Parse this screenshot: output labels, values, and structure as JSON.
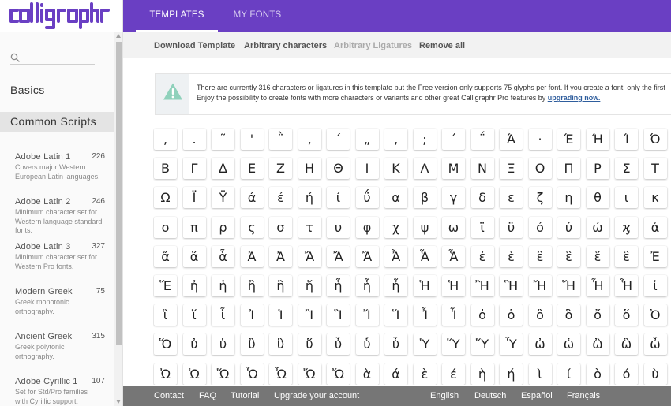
{
  "app": {
    "logo_text": "calligraphr"
  },
  "colors": {
    "accent": "#6a3fc3",
    "footer": "#767676",
    "link": "#2e5d9d"
  },
  "nav": {
    "tabs": [
      {
        "label": "TEMPLATES",
        "active": true
      },
      {
        "label": "MY FONTS",
        "active": false
      }
    ]
  },
  "toolbar": {
    "download_template": "Download Template",
    "arbitrary_characters": "Arbitrary characters",
    "arbitrary_ligatures": "Arbitrary Ligatures",
    "remove_all": "Remove all"
  },
  "sidebar": {
    "search_placeholder": "",
    "basics": "Basics",
    "common_scripts": "Common Scripts",
    "scripts": [
      {
        "name": "Adobe Latin 1",
        "count": "226",
        "desc": [
          "Covers major Western",
          "European Latin languages."
        ]
      },
      {
        "name": "Adobe Latin 2",
        "count": "246",
        "desc": [
          "Minimum character set for",
          "Western language standard",
          "fonts."
        ]
      },
      {
        "name": "Adobe Latin 3",
        "count": "327",
        "desc": [
          "Minimum character set for",
          "Western Pro fonts."
        ]
      },
      {
        "name": "Modern Greek",
        "count": "75",
        "desc": [
          "Greek monotonic",
          "orthography."
        ]
      },
      {
        "name": "Ancient Greek",
        "count": "315",
        "desc": [
          "Greek polytonic",
          "orthography."
        ]
      },
      {
        "name": "Adobe Cyrillic 1",
        "count": "107",
        "desc": [
          "Set for Std/Pro families",
          "with Cyrillic support."
        ]
      }
    ]
  },
  "notice": {
    "line1": "There are currently 316 characters or ligatures in this template but the Free version only supports 75 glyphs per font. If you create a font, only the first",
    "line2": "Enjoy the possibility to create fonts with more characters or variants and other great Calligraphr Pro features by ",
    "link": "upgrading now."
  },
  "glyph_rows": [
    [
      ",",
      ".",
      "˜",
      "'",
      "῭",
      "‚",
      "΄",
      "„",
      "‚",
      ";",
      "΄",
      "΅",
      "Ά",
      "·",
      "Έ",
      "Ή",
      "Ί",
      "Ό"
    ],
    [
      "Β",
      "Γ",
      "Δ",
      "Ε",
      "Ζ",
      "Η",
      "Θ",
      "Ι",
      "Κ",
      "Λ",
      "Μ",
      "Ν",
      "Ξ",
      "Ο",
      "Π",
      "Ρ",
      "Σ",
      "Τ"
    ],
    [
      "Ω",
      "Ϊ",
      "Ϋ",
      "ά",
      "έ",
      "ή",
      "ί",
      "ΰ",
      "α",
      "β",
      "γ",
      "δ",
      "ε",
      "ζ",
      "η",
      "θ",
      "ι",
      "κ"
    ],
    [
      "ο",
      "π",
      "ρ",
      "ς",
      "σ",
      "τ",
      "υ",
      "φ",
      "χ",
      "ψ",
      "ω",
      "ϊ",
      "ϋ",
      "ό",
      "ύ",
      "ώ",
      "ϗ",
      "ἀ"
    ],
    [
      "ἄ",
      "ἅ",
      "ἇ",
      "Ἀ",
      "Ἀ",
      "Ἄ",
      "Ἄ",
      "Ἄ",
      "Ἆ",
      "Ἇ",
      "Ἇ",
      "ἐ",
      "ἑ",
      "ἒ",
      "ἓ",
      "ἕ",
      "ἓ",
      "Ἐ"
    ],
    [
      "Ἕ",
      "ἠ",
      "ἡ",
      "ἢ",
      "ἣ",
      "ἥ",
      "ἧ",
      "ἧ",
      "ἦ",
      "Ἡ",
      "Ἡ",
      "Ἢ",
      "Ἣ",
      "Ἤ",
      "Ἥ",
      "Ἧ",
      "Ἧ",
      "ἰ"
    ],
    [
      "ἳ",
      "ἵ",
      "ἷ",
      "Ἰ",
      "Ἱ",
      "Ἲ",
      "Ἳ",
      "Ἴ",
      "Ἵ",
      "Ἶ",
      "Ἷ",
      "ὀ",
      "ὁ",
      "ὂ",
      "ὃ",
      "ὄ",
      "ὅ",
      "Ὀ"
    ],
    [
      "Ὅ",
      "ὐ",
      "ὑ",
      "ὒ",
      "ὓ",
      "ὕ",
      "ὖ",
      "ὗ",
      "ὗ",
      "Ὑ",
      "Ὕ",
      "Ὕ",
      "Ὗ",
      "ὠ",
      "ὡ",
      "ὢ",
      "ὣ",
      "ὦ"
    ],
    [
      "Ὠ",
      "Ὡ",
      "Ὥ",
      "Ὧ",
      "Ὦ",
      "Ὤ",
      "Ὤ",
      "ὰ",
      "ά",
      "ὲ",
      "έ",
      "ὴ",
      "ή",
      "ὶ",
      "ί",
      "ὸ",
      "ό",
      "ὺ"
    ]
  ],
  "footer": {
    "contact": "Contact",
    "faq": "FAQ",
    "tutorial": "Tutorial",
    "upgrade": "Upgrade your account",
    "lang_en": "English",
    "lang_de": "Deutsch",
    "lang_es": "Español",
    "lang_fr": "Français"
  }
}
